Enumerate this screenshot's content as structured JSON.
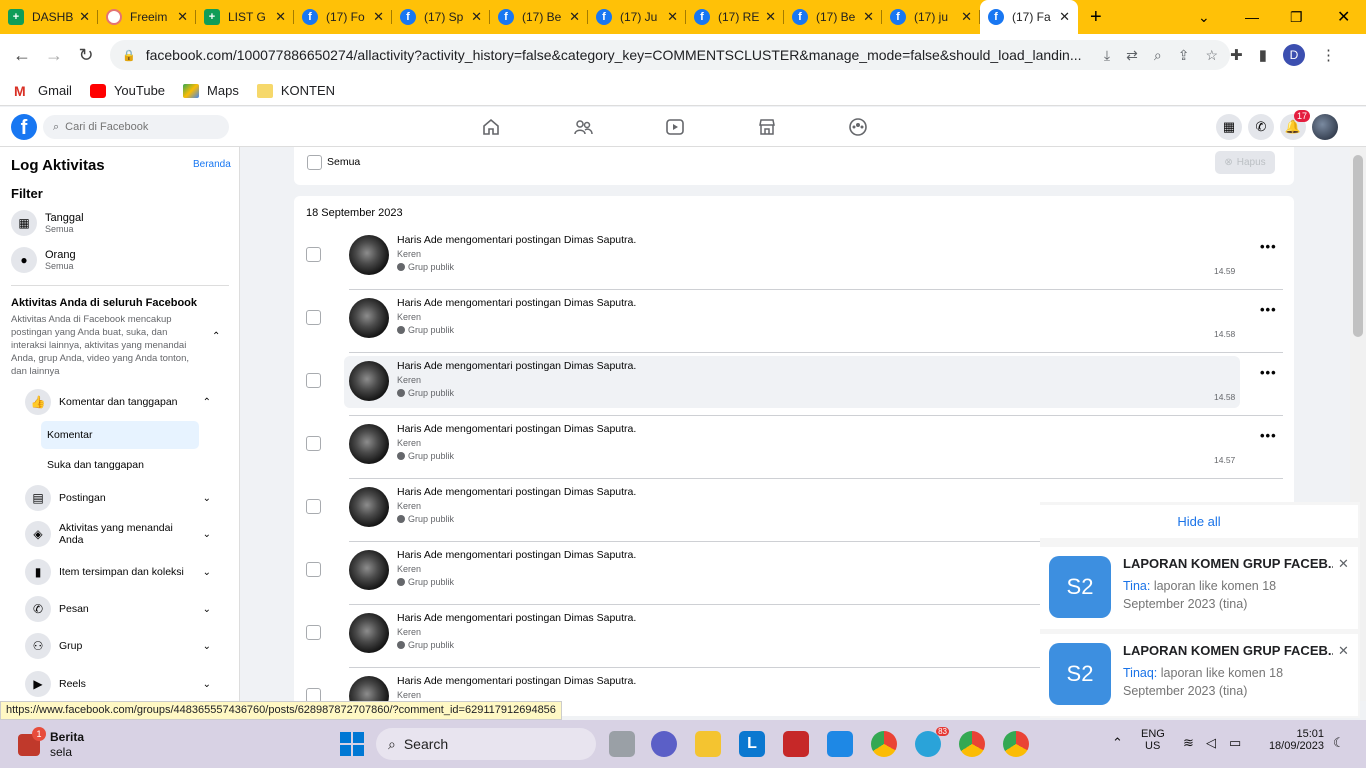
{
  "browser": {
    "tabs": [
      {
        "title": "DASHB",
        "icon": "sheets"
      },
      {
        "title": "Freeim",
        "icon": "free"
      },
      {
        "title": "LIST G",
        "icon": "sheets"
      },
      {
        "title": "(17) Fo",
        "icon": "fb"
      },
      {
        "title": "(17) Sp",
        "icon": "fb"
      },
      {
        "title": "(17) Be",
        "icon": "fb"
      },
      {
        "title": "(17) Ju",
        "icon": "fb"
      },
      {
        "title": "(17) RE",
        "icon": "fb"
      },
      {
        "title": "(17) Be",
        "icon": "fb"
      },
      {
        "title": "(17) ju",
        "icon": "fb"
      },
      {
        "title": "(17) Fa",
        "icon": "fb",
        "active": true
      }
    ],
    "url": "facebook.com/100077886650274/allactivity?activity_history=false&category_key=COMMENTSCLUSTER&manage_mode=false&should_load_landin...",
    "profile_initial": "D",
    "bookmarks": [
      "Gmail",
      "YouTube",
      "Maps",
      "KONTEN"
    ],
    "status_url": "https://www.facebook.com/groups/448365557436760/posts/628987872707860/?comment_id=629117912694856"
  },
  "fb": {
    "search_placeholder": "Cari di Facebook",
    "notif_count": "17"
  },
  "sidebar": {
    "title": "Log Aktivitas",
    "home_link": "Beranda",
    "filter_label": "Filter",
    "filters": [
      {
        "label": "Tanggal",
        "sub": "Semua",
        "icon": "calendar-icon"
      },
      {
        "label": "Orang",
        "sub": "Semua",
        "icon": "person-icon"
      }
    ],
    "section_title": "Aktivitas Anda di seluruh Facebook",
    "section_desc": "Aktivitas Anda di Facebook mencakup postingan yang Anda buat, suka, dan interaksi lainnya, aktivitas yang menandai Anda, grup Anda, video yang Anda tonton, dan lainnya",
    "categories": [
      {
        "label": "Komentar dan tanggapan",
        "icon": "thumbs-up-icon",
        "expanded": true
      },
      {
        "label": "Postingan",
        "icon": "post-icon"
      },
      {
        "label": "Aktivitas yang menandai Anda",
        "icon": "tag-icon"
      },
      {
        "label": "Item tersimpan dan koleksi",
        "icon": "bookmark-icon"
      },
      {
        "label": "Pesan",
        "icon": "messenger-icon"
      },
      {
        "label": "Grup",
        "icon": "group-icon"
      },
      {
        "label": "Reels",
        "icon": "reels-icon"
      }
    ],
    "subcategories": [
      {
        "label": "Komentar",
        "selected": true
      },
      {
        "label": "Suka dan tanggapan"
      }
    ]
  },
  "main": {
    "select_all": "Semua",
    "delete_label": "Hapus",
    "date_header": "18 September 2023",
    "rows": [
      {
        "title": "Haris Ade mengomentari postingan Dimas Saputra.",
        "comment": "Keren",
        "audience": "Grup publik",
        "time": "14.59"
      },
      {
        "title": "Haris Ade mengomentari postingan Dimas Saputra.",
        "comment": "Keren",
        "audience": "Grup publik",
        "time": "14.58"
      },
      {
        "title": "Haris Ade mengomentari postingan Dimas Saputra.",
        "comment": "Keren",
        "audience": "Grup publik",
        "time": "14.58"
      },
      {
        "title": "Haris Ade mengomentari postingan Dimas Saputra.",
        "comment": "Keren",
        "audience": "Grup publik",
        "time": "14.57"
      },
      {
        "title": "Haris Ade mengomentari postingan Dimas Saputra.",
        "comment": "Keren",
        "audience": "Grup publik",
        "time": ""
      },
      {
        "title": "Haris Ade mengomentari postingan Dimas Saputra.",
        "comment": "Keren",
        "audience": "Grup publik",
        "time": ""
      },
      {
        "title": "Haris Ade mengomentari postingan Dimas Saputra.",
        "comment": "Keren",
        "audience": "Grup publik",
        "time": ""
      },
      {
        "title": "Haris Ade mengomentari postingan Dimas Saputra.",
        "comment": "Keren",
        "audience": "",
        "time": ""
      }
    ]
  },
  "notifications": {
    "hide_all": "Hide all",
    "items": [
      {
        "icon_text": "S2",
        "title": "LAPORAN KOMEN GRUP FACEB...",
        "sender": "Tina:",
        "body": "laporan like komen 18 September 2023 (tina)"
      },
      {
        "icon_text": "S2",
        "title": "LAPORAN KOMEN GRUP FACEB...",
        "sender": "Tinaq:",
        "body": "laporan like komen 18 September 2023 (tina)"
      }
    ]
  },
  "taskbar": {
    "news_title": "Berita",
    "news_sub": "sela",
    "news_badge": "1",
    "search_label": "Search",
    "telegram_badge": "83",
    "lang_top": "ENG",
    "lang_bottom": "US",
    "time": "15:01",
    "date": "18/09/2023"
  }
}
